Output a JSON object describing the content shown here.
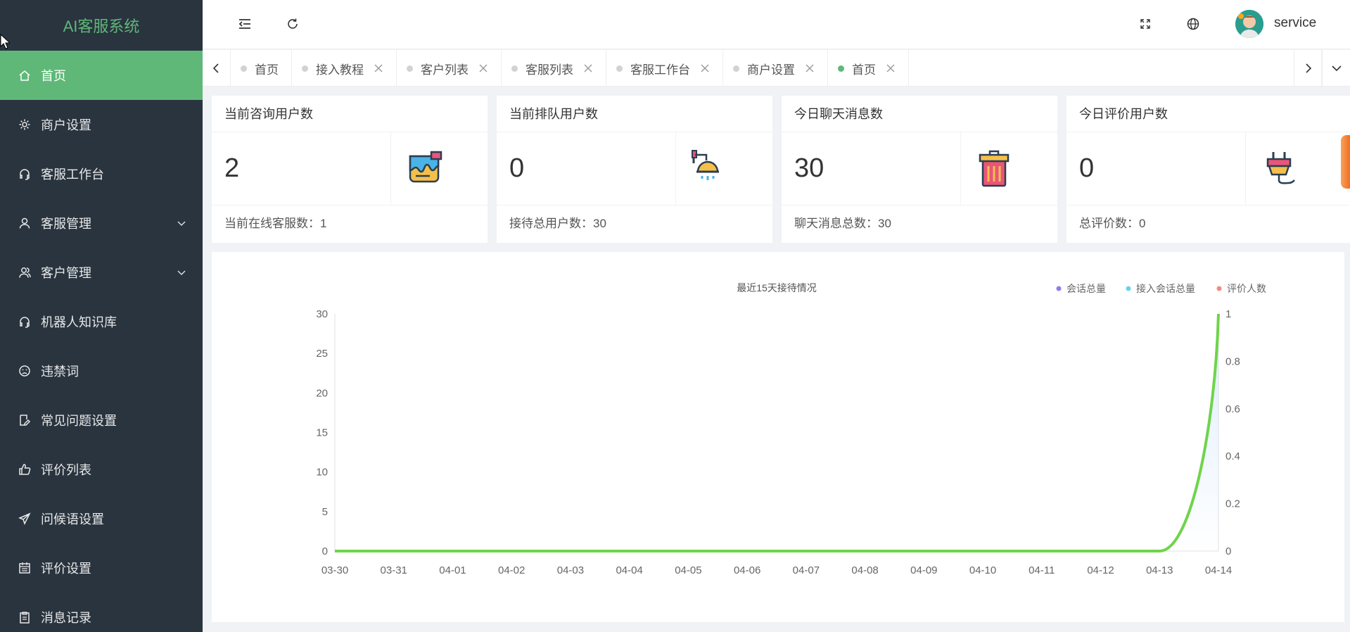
{
  "app": {
    "title": "AI客服系统"
  },
  "sidebar": {
    "items": [
      {
        "label": "首页",
        "icon": "home-icon",
        "active": true
      },
      {
        "label": "商户设置",
        "icon": "gear-icon"
      },
      {
        "label": "客服工作台",
        "icon": "headset-icon"
      },
      {
        "label": "客服管理",
        "icon": "user-icon",
        "expandable": true
      },
      {
        "label": "客户管理",
        "icon": "users-icon",
        "expandable": true
      },
      {
        "label": "机器人知识库",
        "icon": "headset-icon"
      },
      {
        "label": "违禁词",
        "icon": "sad-face-icon"
      },
      {
        "label": "常见问题设置",
        "icon": "edit-icon"
      },
      {
        "label": "评价列表",
        "icon": "thumbs-up-icon"
      },
      {
        "label": "问候语设置",
        "icon": "send-icon"
      },
      {
        "label": "评价设置",
        "icon": "calendar-icon"
      },
      {
        "label": "消息记录",
        "icon": "clipboard-icon"
      }
    ]
  },
  "header": {
    "username": "service"
  },
  "tabs": [
    {
      "label": "首页",
      "closable": false
    },
    {
      "label": "接入教程",
      "closable": true
    },
    {
      "label": "客户列表",
      "closable": true
    },
    {
      "label": "客服列表",
      "closable": true
    },
    {
      "label": "客服工作台",
      "closable": true
    },
    {
      "label": "商户设置",
      "closable": true
    },
    {
      "label": "首页",
      "closable": true,
      "active": true
    }
  ],
  "cards": [
    {
      "title": "当前咨询用户数",
      "value": "2",
      "footer": "当前在线客服数：1",
      "icon": "paint-bucket-icon"
    },
    {
      "title": "当前排队用户数",
      "value": "0",
      "footer": "接待总用户数：30",
      "icon": "shower-icon"
    },
    {
      "title": "今日聊天消息数",
      "value": "30",
      "footer": "聊天消息总数：30",
      "icon": "trash-bin-icon"
    },
    {
      "title": "今日评价用户数",
      "value": "0",
      "footer": "总评价数：0",
      "icon": "plug-icon"
    }
  ],
  "colors": {
    "accent": "#5fb878",
    "sidebar_bg": "#29343f",
    "series_total": "#8e7cf0",
    "series_access": "#6bd0ef",
    "series_rating": "#f28b82"
  },
  "chart_data": {
    "type": "line",
    "title": "最近15天接待情况",
    "categories": [
      "03-30",
      "03-31",
      "04-01",
      "04-02",
      "04-03",
      "04-04",
      "04-05",
      "04-06",
      "04-07",
      "04-08",
      "04-09",
      "04-10",
      "04-11",
      "04-12",
      "04-13",
      "04-14"
    ],
    "series": [
      {
        "name": "会话总量",
        "axis": "left",
        "values": [
          0,
          0,
          0,
          0,
          0,
          0,
          0,
          0,
          0,
          0,
          0,
          0,
          0,
          0,
          0,
          30
        ]
      },
      {
        "name": "接入会话总量",
        "axis": "left",
        "values": [
          0,
          0,
          0,
          0,
          0,
          0,
          0,
          0,
          0,
          0,
          0,
          0,
          0,
          0,
          0,
          30
        ]
      },
      {
        "name": "评价人数",
        "axis": "right",
        "values": [
          0,
          0,
          0,
          0,
          0,
          0,
          0,
          0,
          0,
          0,
          0,
          0,
          0,
          0,
          0,
          0
        ]
      }
    ],
    "y_left_ticks": [
      "0",
      "5",
      "10",
      "15",
      "20",
      "25",
      "30"
    ],
    "y_right_ticks": [
      "0",
      "0.2",
      "0.4",
      "0.6",
      "0.8",
      "1"
    ],
    "ylim_left": [
      0,
      30
    ],
    "ylim_right": [
      0,
      1
    ],
    "legend_position": "top-right",
    "grid": false
  }
}
